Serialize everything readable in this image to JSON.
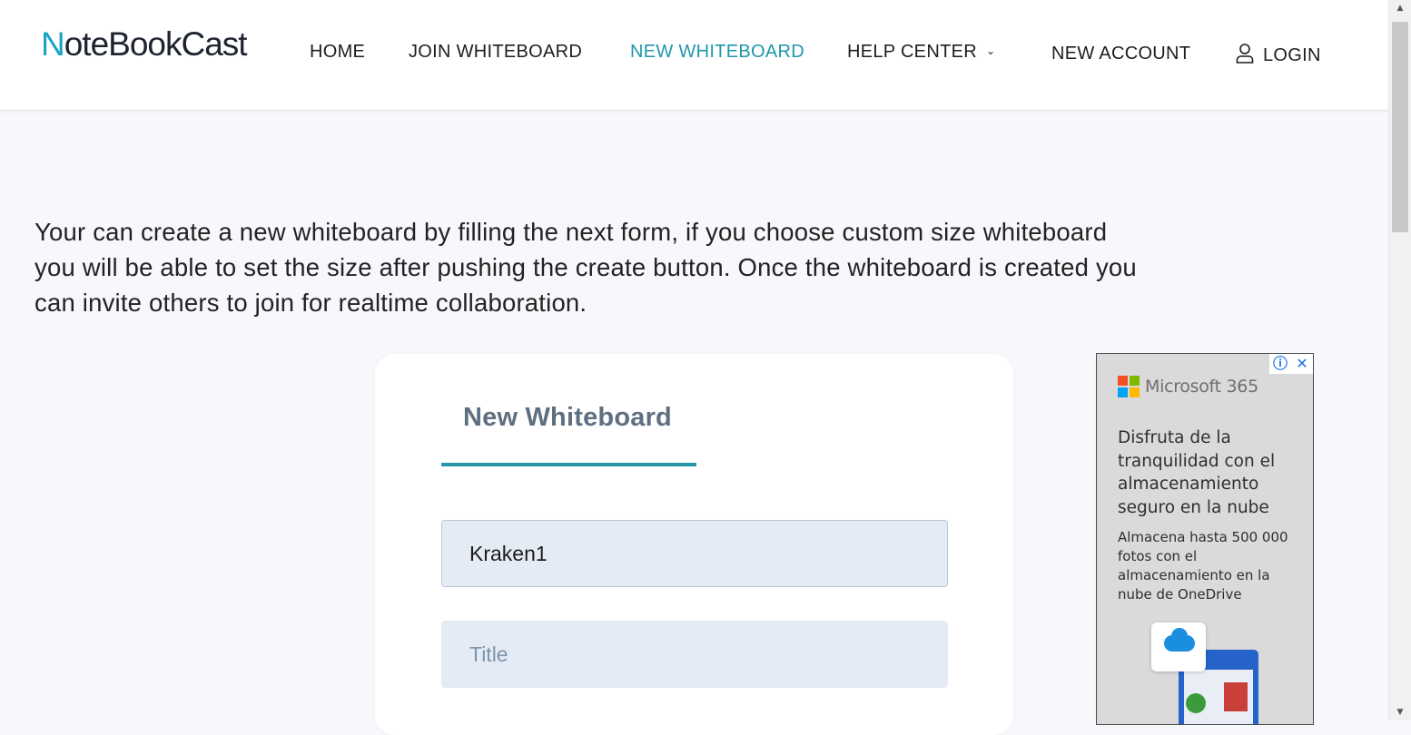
{
  "header": {
    "logo_first": "N",
    "logo_rest": "oteBookCast",
    "nav": {
      "home": "HOME",
      "join": "JOIN WHITEBOARD",
      "new": "NEW WHITEBOARD",
      "help": "HELP CENTER",
      "account": "NEW ACCOUNT",
      "login": "LOGIN"
    },
    "accent_color": "#1f97ab"
  },
  "intro": {
    "line1": "Your can create a new whiteboard by filling the next form, if you choose custom size whiteboard",
    "line2": "you will be able to set the size after pushing the create button. Once the whiteboard is created you",
    "line3": "can invite others to join for realtime collaboration."
  },
  "form": {
    "tab_label": "New Whiteboard",
    "name_value": "Kraken1",
    "title_placeholder": "Title"
  },
  "ad": {
    "brand": "Microsoft 365",
    "headline": "Disfruta de la tranquilidad con el almacenamiento seguro en la nube",
    "body": "Almacena hasta 500 000 fotos con el almacenamiento en la nube de OneDrive",
    "info_icon": "info-icon",
    "close_icon": "close-icon"
  }
}
